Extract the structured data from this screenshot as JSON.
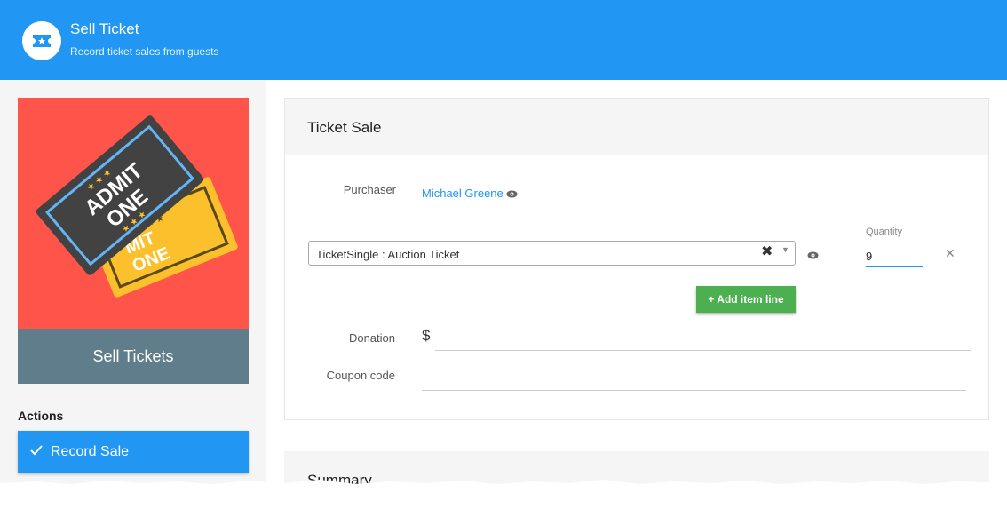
{
  "header": {
    "title": "Sell Ticket",
    "subtitle": "Record ticket sales from guests",
    "icon": "ticket-star-icon"
  },
  "sidebar": {
    "card_caption": "Sell Tickets",
    "card_image_text": [
      "ADMIT",
      "ONE"
    ],
    "actions_label": "Actions",
    "record_sale_label": "Record Sale"
  },
  "ticket_sale": {
    "title": "Ticket Sale",
    "purchaser_label": "Purchaser",
    "purchaser_name": "Michael Greene",
    "item_select_value": "TicketSingle : Auction Ticket",
    "clear_symbol": "✖",
    "quantity_label": "Quantity",
    "quantity_value": "9",
    "remove_symbol": "✕",
    "add_item_label": "+ Add item line",
    "donation_label": "Donation",
    "currency_symbol": "$",
    "coupon_label": "Coupon code"
  },
  "summary": {
    "title": "Summary"
  },
  "colors": {
    "header": "#2196f3",
    "card_bg": "#ff5449",
    "caption_bg": "#607d8b",
    "add_button": "#4caf50",
    "link": "#2196f3"
  }
}
